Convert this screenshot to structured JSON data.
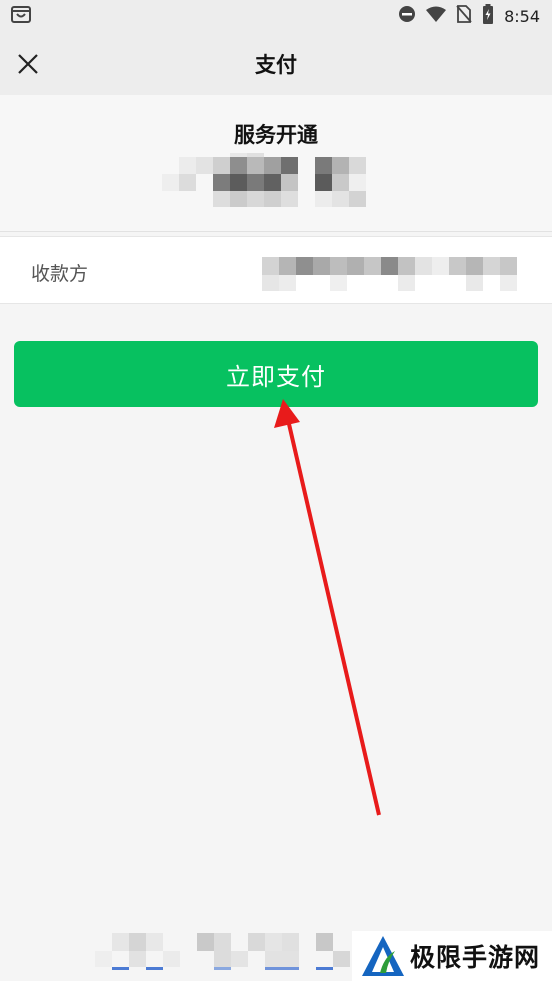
{
  "status_bar": {
    "time": "8:54",
    "icons": [
      "app-notification-icon",
      "do-not-disturb-icon",
      "wifi-icon",
      "no-sim-icon",
      "battery-charging-icon"
    ]
  },
  "nav": {
    "title": "支付",
    "close_icon": "close-icon"
  },
  "merchant": {
    "name": "服务开通"
  },
  "payee": {
    "label": "收款方"
  },
  "pay_button": {
    "label": "立即支付"
  },
  "watermark": {
    "text": "极限手游网"
  },
  "colors": {
    "accent": "#07c160",
    "arrow": "#e81b1b",
    "background": "#f5f5f5"
  }
}
